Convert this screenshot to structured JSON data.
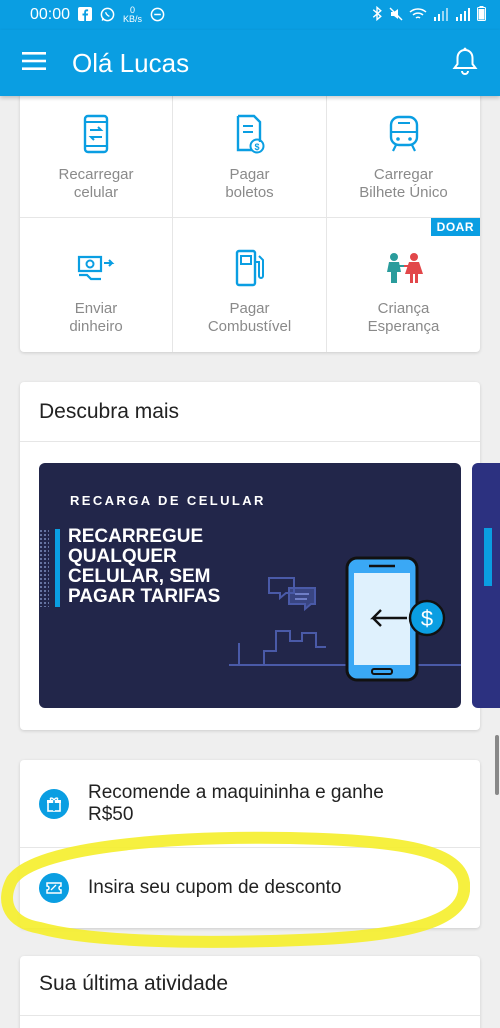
{
  "status_bar": {
    "time": "00:00",
    "speed": "0\nKB/s",
    "icons": [
      "facebook-icon",
      "whatsapp-icon",
      "minus-circle-icon",
      "bluetooth-icon",
      "mute-icon",
      "wifi-icon",
      "signal-icon",
      "battery-icon"
    ]
  },
  "app_bar": {
    "title": "Olá Lucas",
    "menu_icon": "menu-icon",
    "bell_icon": "bell-icon"
  },
  "services": {
    "items": [
      {
        "label": "Recarregar\ncelular",
        "icon": "phone-refresh-icon"
      },
      {
        "label": "Pagar\nboletos",
        "icon": "bill-icon"
      },
      {
        "label": "Carregar\nBilhete Único",
        "icon": "bus-icon"
      },
      {
        "label": "Enviar\ndinheiro",
        "icon": "send-money-icon"
      },
      {
        "label": "Pagar\nCombustível",
        "icon": "fuel-pump-icon"
      },
      {
        "label": "Criança\nEsperança",
        "icon": "children-icon",
        "badge": "DOAR"
      }
    ]
  },
  "discover": {
    "title": "Descubra mais",
    "banner": {
      "kicker": "RECARGA DE CELULAR",
      "headline": "RECARREGUE\nQUALQUER\nCELULAR, SEM\nPAGAR TARIFAS",
      "currency_symbol": "$"
    }
  },
  "actions": [
    {
      "label": "Recomende a maquininha e ganhe\nR$50",
      "icon": "gift-icon"
    },
    {
      "label": "Insira seu cupom de desconto",
      "icon": "coupon-icon"
    }
  ],
  "activity": {
    "title": "Sua última atividade"
  },
  "colors": {
    "primary": "#0a9ee2",
    "banner_bg": "#22264a",
    "highlight": "#f5ee2a"
  }
}
